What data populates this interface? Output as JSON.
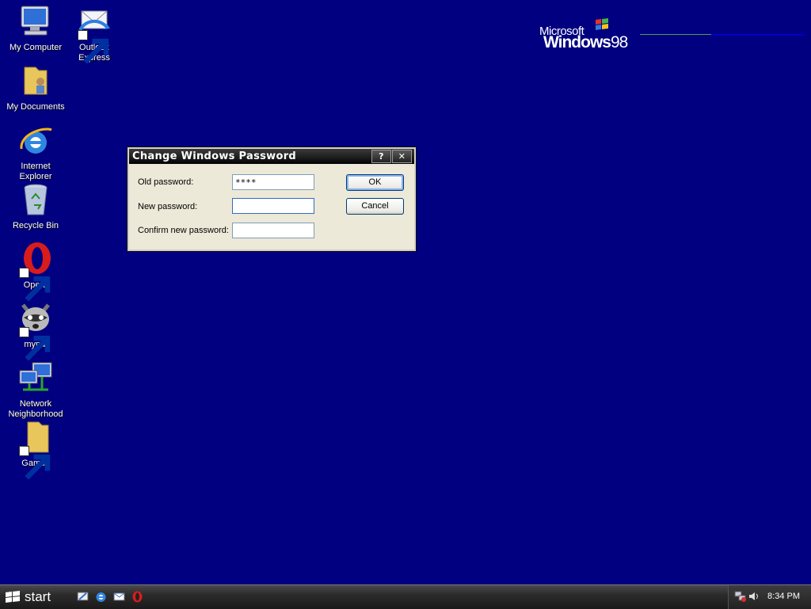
{
  "desktop": {
    "icons": [
      {
        "label": "My Computer"
      },
      {
        "label": "Outlook Express"
      },
      {
        "label": "My Documents"
      },
      {
        "label": "Internet Explorer"
      },
      {
        "label": "Recycle Bin"
      },
      {
        "label": "Opera"
      },
      {
        "label": "mypal"
      },
      {
        "label": "Network\nNeighborhood"
      },
      {
        "label": "Games"
      }
    ],
    "logo": {
      "microsoft": "Microsoft",
      "windows": "Windows",
      "version": "98"
    }
  },
  "dialog": {
    "title": "Change Windows Password",
    "help_label": "?",
    "close_label": "✕",
    "old_password_label": "Old password:",
    "old_password_value": "****",
    "new_password_label": "New password:",
    "new_password_value": "",
    "confirm_password_label": "Confirm new password:",
    "confirm_password_value": "",
    "ok_label": "OK",
    "cancel_label": "Cancel"
  },
  "taskbar": {
    "start_label": "start",
    "quick_launch": [
      "show-desktop-icon",
      "internet-explorer-icon",
      "outlook-express-icon",
      "opera-icon"
    ],
    "tray_icons": [
      "network-icon",
      "volume-icon"
    ],
    "clock": "8:34 PM"
  },
  "colors": {
    "desktop": "#010080",
    "accent": "#316ac5"
  }
}
